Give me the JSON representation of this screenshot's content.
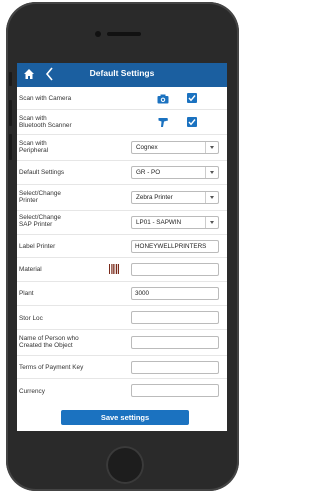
{
  "header": {
    "title": "Default Settings"
  },
  "settings": {
    "scan_camera_label": "Scan with Camera",
    "scan_bt_label": "Scan with\nBluetooth Scanner",
    "scan_peripheral_label": "Scan with\nPeripheral",
    "scan_peripheral_value": "Cognex",
    "default_settings_label": "Default Settings",
    "default_settings_value": "GR - PO",
    "printer_label": "Select/Change\nPrinter",
    "printer_value": "Zebra Printer",
    "sap_printer_label": "Select/Change\nSAP Printer",
    "sap_printer_value": "LP01 - SAPWIN",
    "label_printer_label": "Label Printer",
    "label_printer_value": "HONEYWELLPRINTERS",
    "material_label": "Material",
    "material_value": "",
    "plant_label": "Plant",
    "plant_value": "3000",
    "stor_loc_label": "Stor Loc",
    "stor_loc_value": "",
    "creator_label": "Name of Person who\nCreated the Object",
    "creator_value": "",
    "payment_label": "Terms of Payment Key",
    "payment_value": "",
    "currency_label": "Currency",
    "currency_value": ""
  },
  "actions": {
    "save_label": "Save settings"
  },
  "colors": {
    "accent": "#1b72c0",
    "header": "#1b5fa0"
  }
}
